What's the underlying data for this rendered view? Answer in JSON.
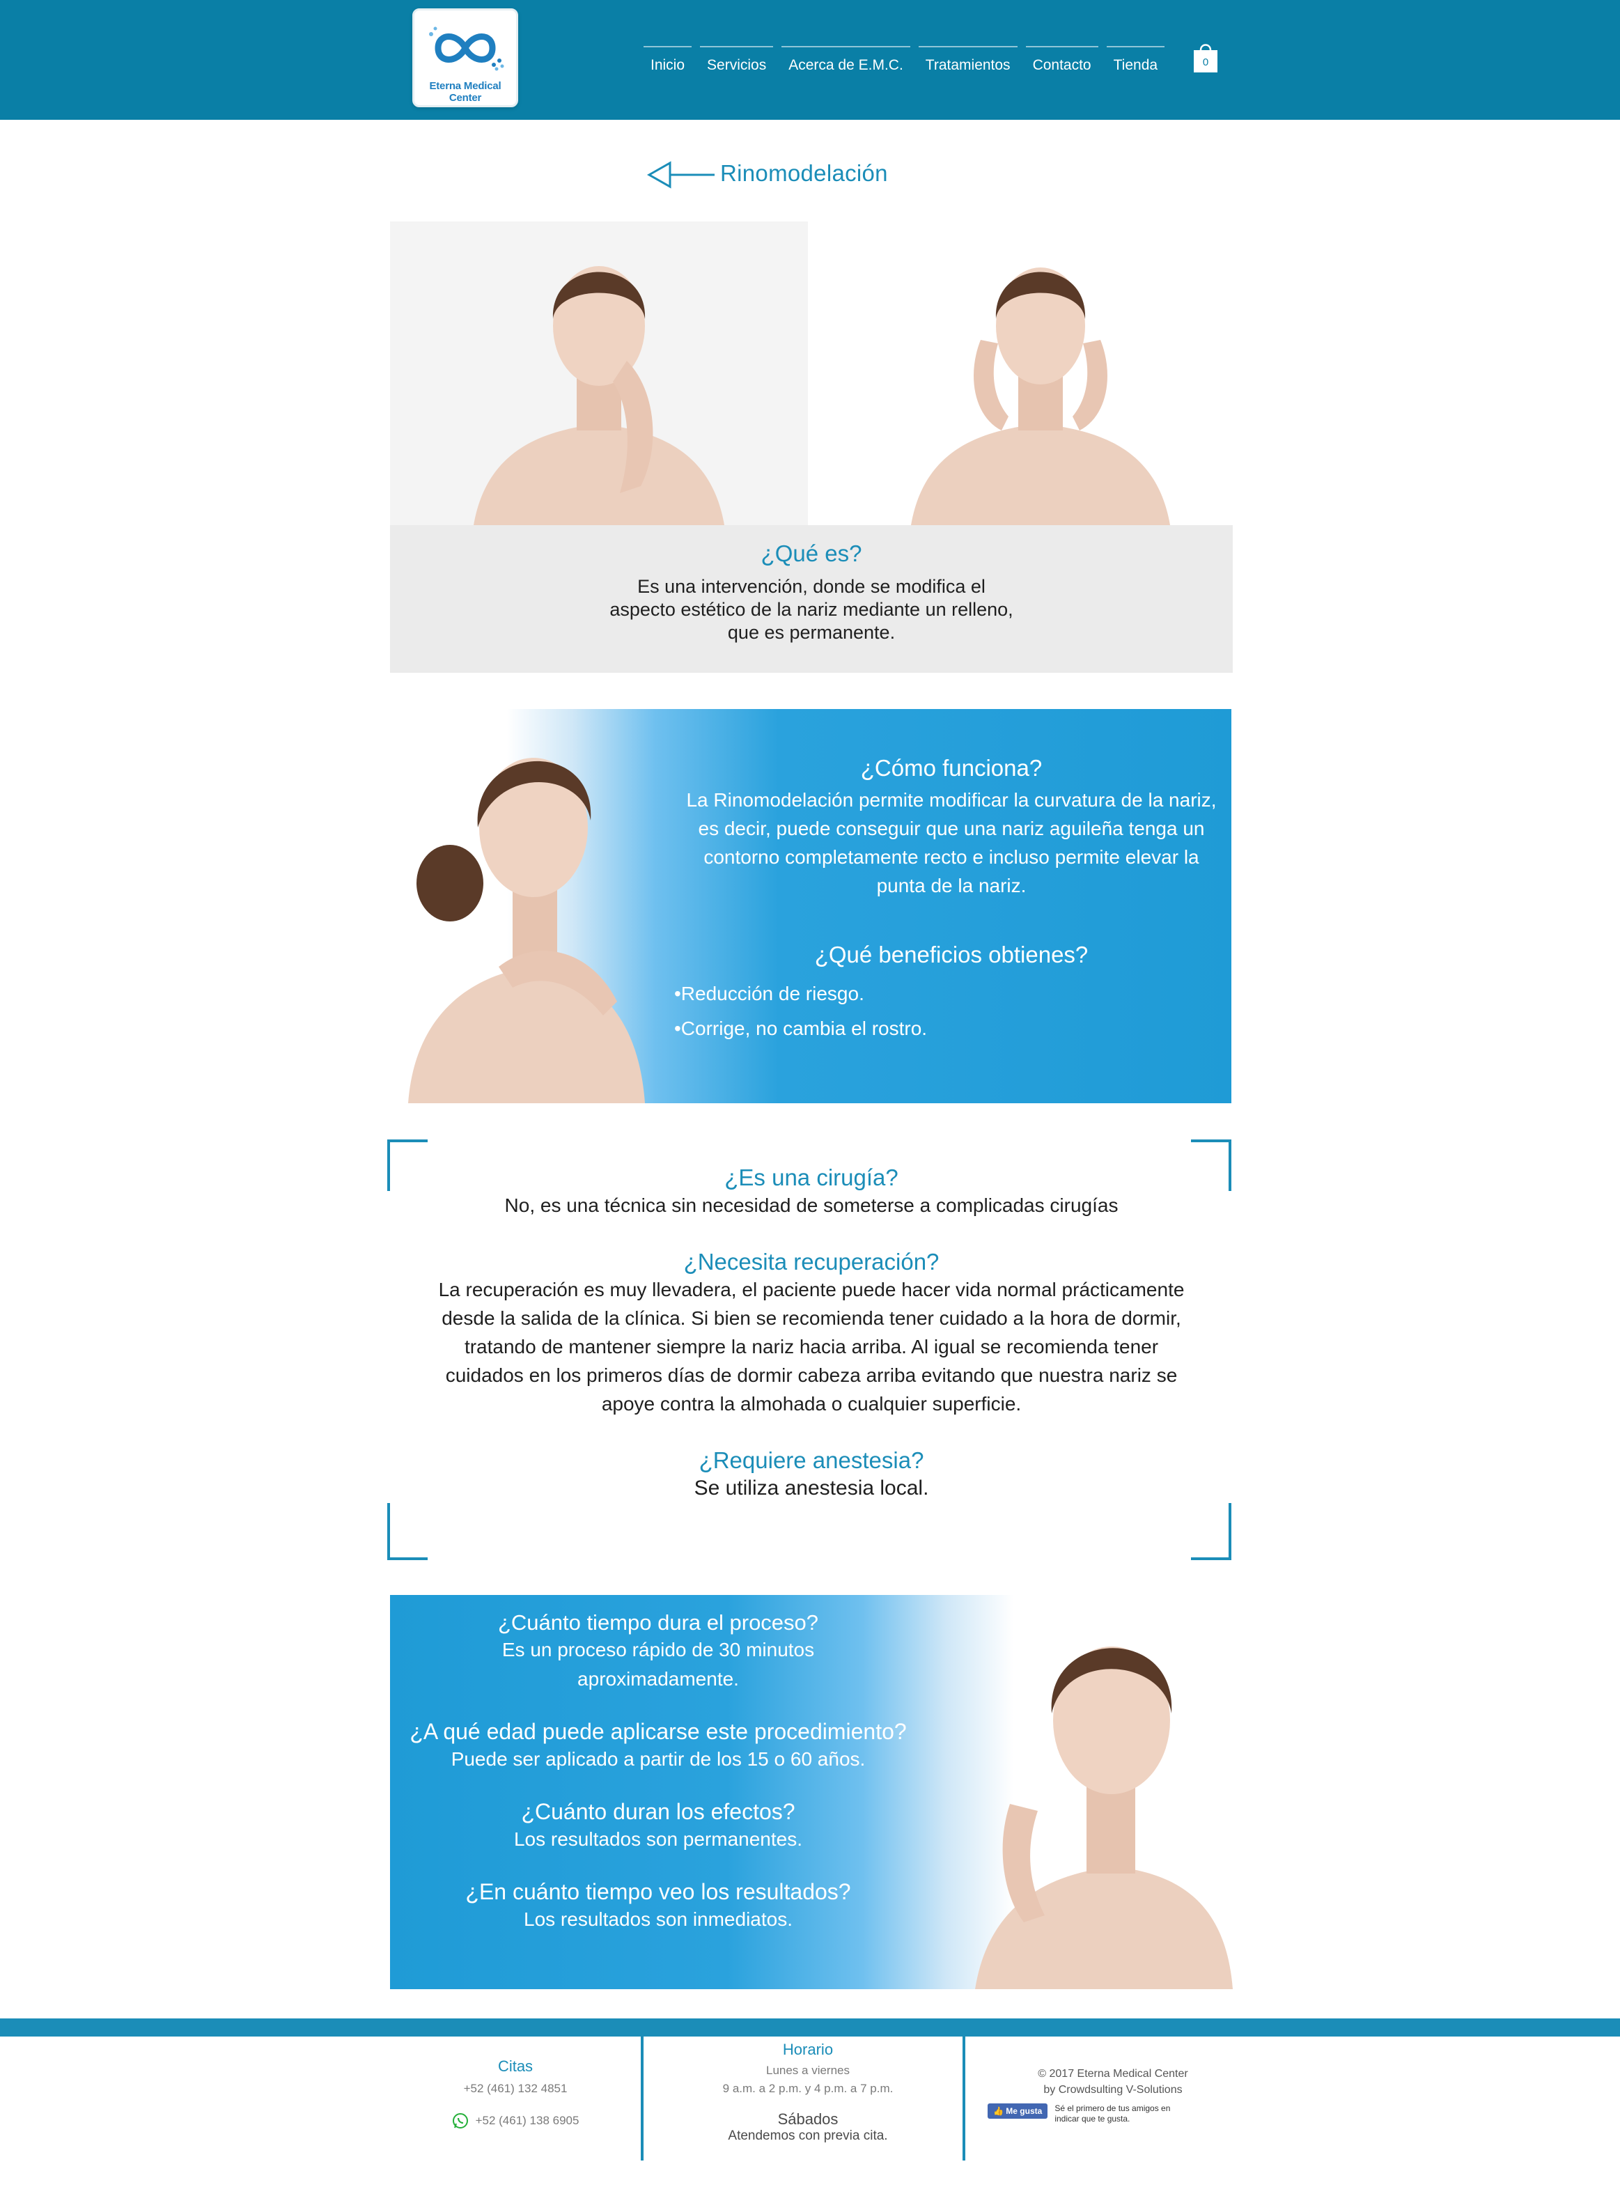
{
  "header": {
    "logo_text": "Eterna Medical Center",
    "nav": [
      "Inicio",
      "Servicios",
      "Acerca de E.M.C.",
      "Tratamientos",
      "Contacto",
      "Tienda"
    ],
    "cart_count": "0"
  },
  "page": {
    "title": "Rinomodelación"
  },
  "que_es": {
    "heading": "¿Qué es?",
    "text": "Es una intervención, donde se modifica el aspecto estético de la nariz mediante un relleno, que es permanente."
  },
  "funciona": {
    "heading": "¿Cómo funciona?",
    "text": "La Rinomodelación permite modificar la curvatura de la nariz, es decir, puede conseguir que una nariz aguileña tenga un contorno completamente recto e incluso permite elevar la punta de la nariz.",
    "benefits_heading": "¿Qué beneficios obtienes?",
    "benefits": [
      "•Reducción de riesgo.",
      "•Corrige, no cambia el rostro."
    ]
  },
  "faq": {
    "cirugia_q": "¿Es una cirugía?",
    "cirugia_a": "No, es una técnica sin necesidad de someterse a complicadas cirugías",
    "recuperacion_q": "¿Necesita recuperación?",
    "recuperacion_a": "La recuperación es muy llevadera, el paciente puede hacer vida normal prácticamente desde la salida de la clínica. Si bien se recomienda tener cuidado a la hora de dormir, tratando de mantener siempre la nariz hacia arriba. Al igual se recomienda tener cuidados en los primeros días de dormir cabeza arriba evitando que nuestra nariz se apoye contra la almohada o cualquier superficie.",
    "anestesia_q": "¿Requiere anestesia?",
    "anestesia_a": "Se utiliza anestesia local."
  },
  "timing": {
    "dura_q": "¿Cuánto tiempo dura el proceso?",
    "dura_a": "Es un proceso rápido de 30 minutos aproximadamente.",
    "edad_q": "¿A qué edad puede aplicarse este procedimiento?",
    "edad_a": "Puede ser aplicado a partir de los 15 o 60 años.",
    "efectos_q": "¿Cuánto duran los efectos?",
    "efectos_a": "Los resultados son permanentes.",
    "resultados_q": "¿En cuánto tiempo veo los resultados?",
    "resultados_a": "Los resultados son inmediatos."
  },
  "footer": {
    "citas_title": "Citas",
    "phone1": "+52 (461) 132 4851",
    "phone2": "+52 (461) 138 6905",
    "horario_title": "Horario",
    "weekdays": "Lunes a viernes",
    "hours": "9 a.m. a 2 p.m. y 4 p.m. a 7 p.m.",
    "sabados": "Sábados",
    "sabados_note": "Atendemos con previa cita.",
    "copyright": "© 2017 Eterna Medical Center",
    "credit": "by Crowdsulting V-Solutions",
    "fb_button": "Me gusta",
    "fb_text": "Sé el primero de tus amigos en indicar que te gusta."
  },
  "colors": {
    "brand": "#0a7fa6",
    "accent": "#1b8db8",
    "section_blue": "#1f9bd6",
    "grey": "#ebebeb"
  },
  "icons": {
    "logo": "infinity-icon",
    "cart": "shopping-bag-icon",
    "back": "back-arrow-icon",
    "whatsapp": "whatsapp-icon"
  }
}
